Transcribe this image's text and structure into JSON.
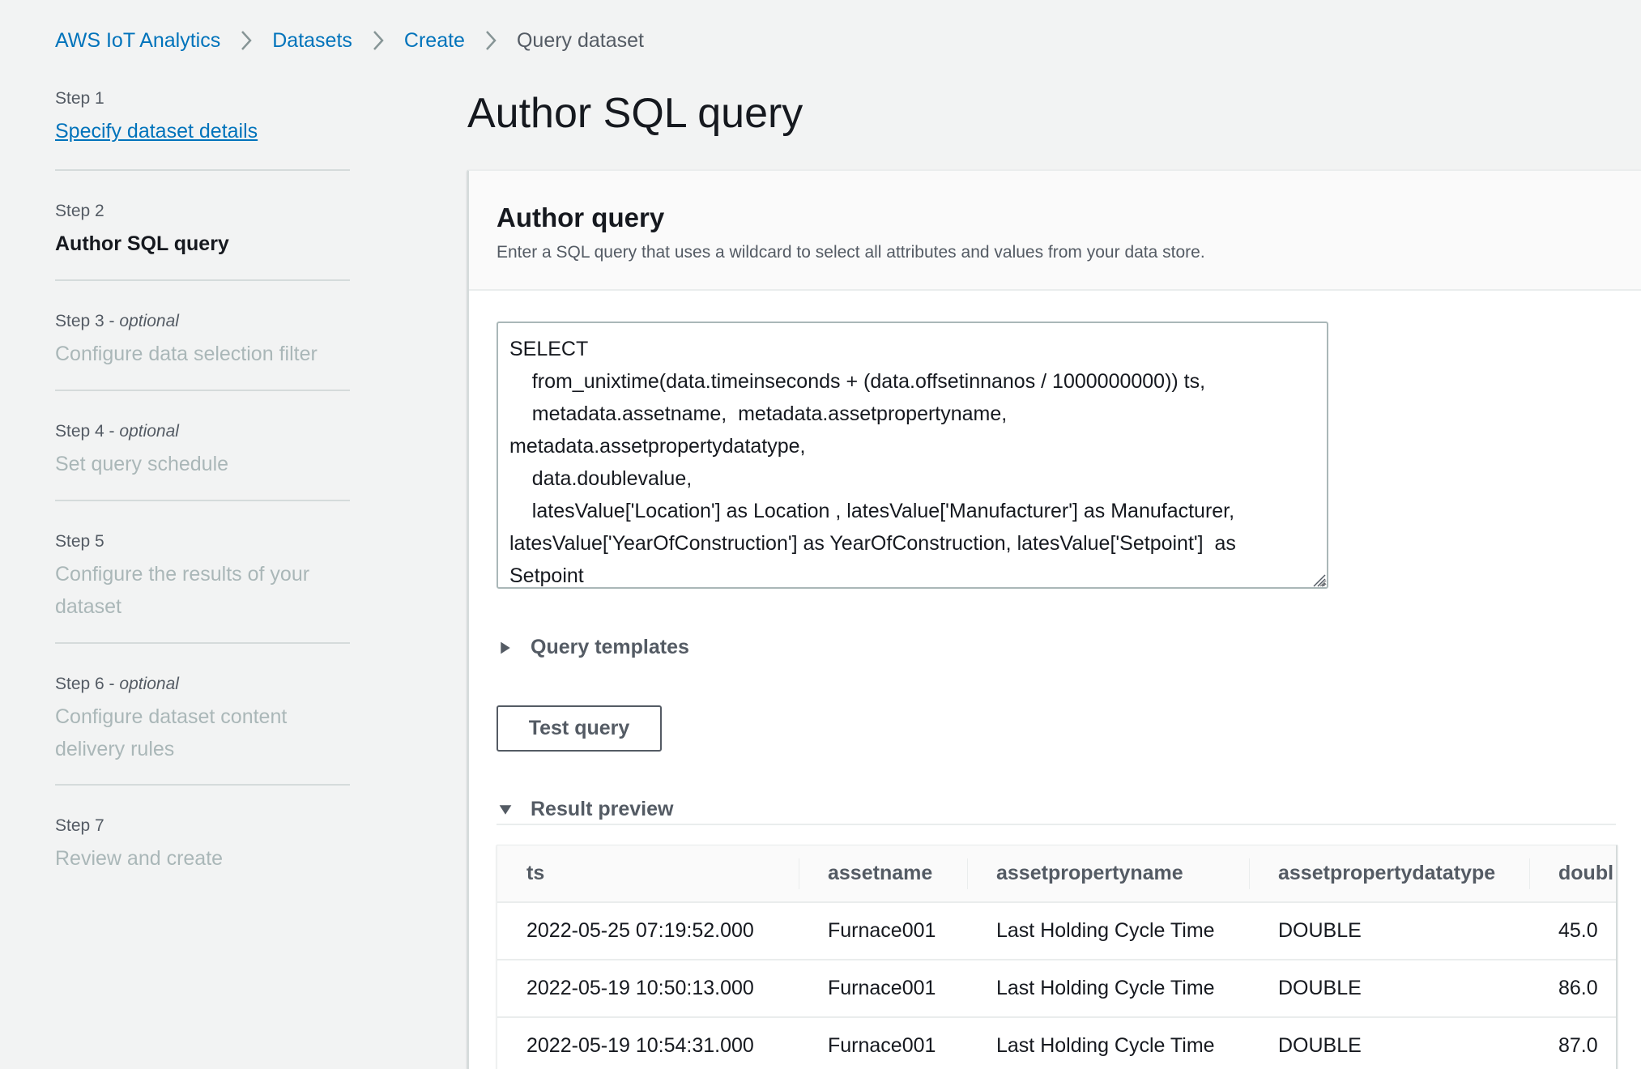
{
  "breadcrumb": {
    "items": [
      {
        "label": "AWS IoT Analytics",
        "link": true
      },
      {
        "label": "Datasets",
        "link": true
      },
      {
        "label": "Create",
        "link": true
      },
      {
        "label": "Query dataset",
        "link": false
      }
    ]
  },
  "steps": [
    {
      "number": "Step 1",
      "optional": "",
      "title": "Specify dataset details",
      "state": "completed"
    },
    {
      "number": "Step 2",
      "optional": "",
      "title": "Author SQL query",
      "state": "current"
    },
    {
      "number": "Step 3 - ",
      "optional": "optional",
      "title": "Configure data selection filter",
      "state": "disabled"
    },
    {
      "number": "Step 4 - ",
      "optional": "optional",
      "title": "Set query schedule",
      "state": "disabled"
    },
    {
      "number": "Step 5",
      "optional": "",
      "title": "Configure the results of your dataset",
      "state": "disabled"
    },
    {
      "number": "Step 6 - ",
      "optional": "optional",
      "title": "Configure dataset content delivery rules",
      "state": "disabled"
    },
    {
      "number": "Step 7",
      "optional": "",
      "title": "Review and create",
      "state": "disabled"
    }
  ],
  "page_title": "Author SQL query",
  "panel": {
    "title": "Author query",
    "description": "Enter a SQL query that uses a wildcard to select all attributes and values from your data store.",
    "sql_query": "SELECT\n    from_unixtime(data.timeinseconds + (data.offsetinnanos / 1000000000)) ts,\n    metadata.assetname,  metadata.assetpropertyname,\nmetadata.assetpropertydatatype,\n    data.doublevalue,\n    latesValue['Location'] as Location , latesValue['Manufacturer'] as Manufacturer,\nlatesValue['YearOfConstruction'] as YearOfConstruction, latesValue['Setpoint']  as\nSetpoint",
    "query_templates_label": "Query templates",
    "query_templates_expanded": false,
    "test_query_label": "Test query",
    "result_preview_label": "Result preview",
    "result_preview_expanded": true
  },
  "result_table": {
    "columns": [
      "ts",
      "assetname",
      "assetpropertyname",
      "assetpropertydatatype",
      "doubl"
    ],
    "rows": [
      [
        "2022-05-25 07:19:52.000",
        "Furnace001",
        "Last Holding Cycle Time",
        "DOUBLE",
        "45.0"
      ],
      [
        "2022-05-19 10:50:13.000",
        "Furnace001",
        "Last Holding Cycle Time",
        "DOUBLE",
        "86.0"
      ],
      [
        "2022-05-19 10:54:31.000",
        "Furnace001",
        "Last Holding Cycle Time",
        "DOUBLE",
        "87.0"
      ]
    ]
  },
  "colors": {
    "link": "#0073bb",
    "text_primary": "#16191f",
    "text_secondary": "#545b64",
    "text_disabled": "#aab7b8",
    "background": "#f2f3f3"
  },
  "icons": {
    "breadcrumb_separator": "chevron-right-icon",
    "collapsed": "caret-right-icon",
    "expanded": "caret-down-icon",
    "resize": "resize-handle-icon"
  }
}
